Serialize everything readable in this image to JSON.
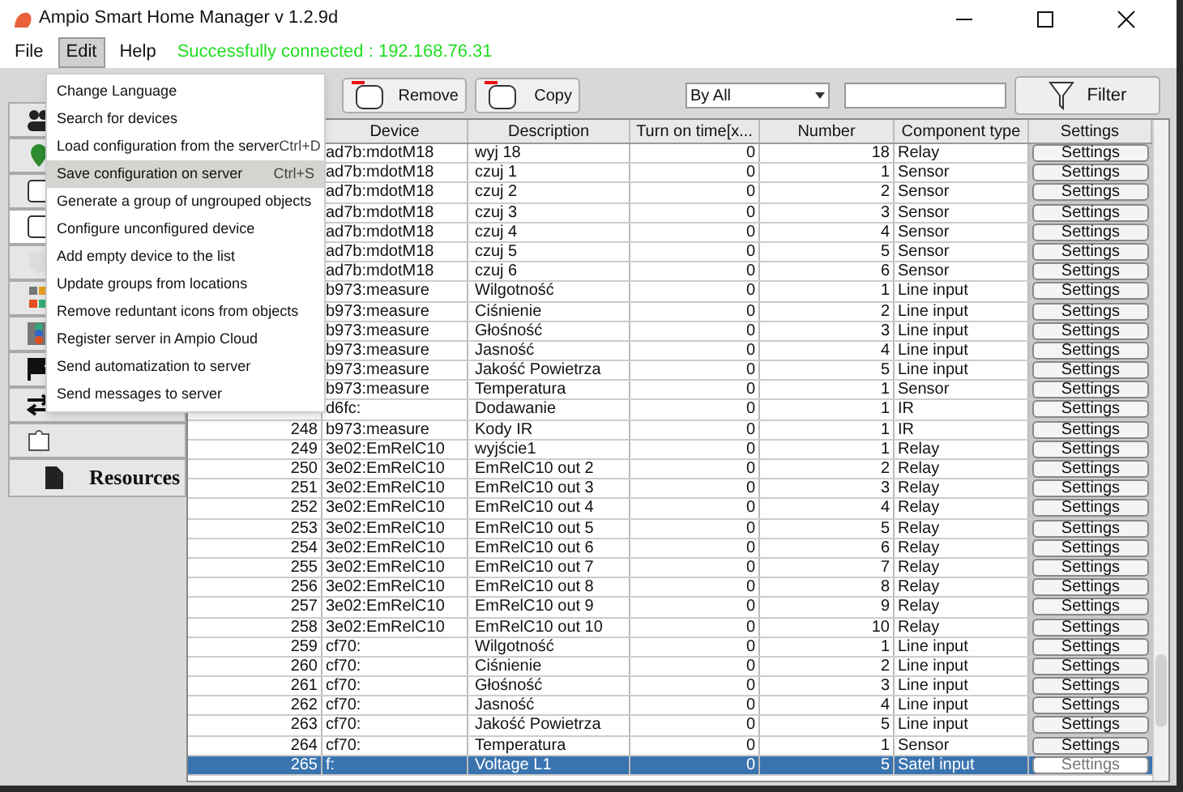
{
  "window": {
    "title": "Ampio Smart Home Manager v 1.2.9d"
  },
  "menubar": {
    "items": [
      {
        "label": "File",
        "selected": false
      },
      {
        "label": "Edit",
        "selected": true
      },
      {
        "label": "Help",
        "selected": false
      }
    ],
    "status": "Successfully connected : 192.168.76.31"
  },
  "toolbar": {
    "remove": "Remove",
    "copy": "Copy",
    "filter_select": "By All",
    "filter": "Filter"
  },
  "sidebar": {
    "items": [
      {
        "kind": "people",
        "selected": false
      },
      {
        "kind": "pin",
        "selected": false
      },
      {
        "kind": "box",
        "selected": false
      },
      {
        "kind": "box",
        "selected": true
      },
      {
        "kind": "shield",
        "selected": false
      },
      {
        "kind": "blocks",
        "selected": false
      },
      {
        "kind": "dots",
        "selected": false
      },
      {
        "kind": "flag",
        "selected": false
      },
      {
        "kind": "arrows",
        "selected": false
      },
      {
        "kind": "puzzle",
        "selected": false
      }
    ],
    "resources": "Resources"
  },
  "menu": {
    "items": [
      {
        "label": "Change Language",
        "selected": false
      },
      {
        "label": "Search for devices",
        "selected": false
      },
      {
        "label": "Load configuration from the server",
        "shortcut": "Ctrl+D",
        "selected": false
      },
      {
        "label": "Save configuration on server",
        "shortcut": "Ctrl+S",
        "selected": true
      },
      {
        "label": "Generate a group of ungrouped objects",
        "selected": false
      },
      {
        "label": "Configure unconfigured device",
        "selected": false
      },
      {
        "label": "Add empty device to the list",
        "selected": false
      },
      {
        "label": "Update groups from locations",
        "selected": false
      },
      {
        "label": "Remove reduntant icons from objects",
        "selected": false
      },
      {
        "label": "Register server in Ampio Cloud",
        "selected": false
      },
      {
        "label": "Send automatization to server",
        "selected": false
      },
      {
        "label": "Send messages to server",
        "selected": false
      }
    ]
  },
  "table": {
    "columns": [
      "Device",
      "Description",
      "Turn on time[x...",
      "Number",
      "Component type",
      "Settings"
    ],
    "rows": [
      {
        "device": "ad7b:mdotM18",
        "description": "wyj 18",
        "time": "0",
        "number": "18",
        "type": "Relay",
        "settings": "Settings",
        "selected": false
      },
      {
        "device": "ad7b:mdotM18",
        "description": "czuj 1",
        "time": "0",
        "number": "1",
        "type": "Sensor",
        "settings": "Settings",
        "selected": false
      },
      {
        "device": "ad7b:mdotM18",
        "description": "czuj 2",
        "time": "0",
        "number": "2",
        "type": "Sensor",
        "settings": "Settings",
        "selected": false
      },
      {
        "device": "ad7b:mdotM18",
        "description": "czuj 3",
        "time": "0",
        "number": "3",
        "type": "Sensor",
        "settings": "Settings",
        "selected": false
      },
      {
        "device": "ad7b:mdotM18",
        "description": "czuj 4",
        "time": "0",
        "number": "4",
        "type": "Sensor",
        "settings": "Settings",
        "selected": false
      },
      {
        "device": "ad7b:mdotM18",
        "description": "czuj 5",
        "time": "0",
        "number": "5",
        "type": "Sensor",
        "settings": "Settings",
        "selected": false
      },
      {
        "device": "ad7b:mdotM18",
        "description": "czuj 6",
        "time": "0",
        "number": "6",
        "type": "Sensor",
        "settings": "Settings",
        "selected": false
      },
      {
        "device": "b973:measure",
        "description": "Wilgotność",
        "time": "0",
        "number": "1",
        "type": "Line input",
        "settings": "Settings",
        "selected": false
      },
      {
        "device": "b973:measure",
        "description": "Ciśnienie",
        "time": "0",
        "number": "2",
        "type": "Line input",
        "settings": "Settings",
        "selected": false
      },
      {
        "device": "b973:measure",
        "description": "Głośność",
        "time": "0",
        "number": "3",
        "type": "Line input",
        "settings": "Settings",
        "selected": false
      },
      {
        "device": "b973:measure",
        "description": "Jasność",
        "time": "0",
        "number": "4",
        "type": "Line input",
        "settings": "Settings",
        "selected": false
      },
      {
        "device": "b973:measure",
        "description": "Jakość Powietrza",
        "time": "0",
        "number": "5",
        "type": "Line input",
        "settings": "Settings",
        "selected": false
      },
      {
        "device": "b973:measure",
        "description": "Temperatura",
        "time": "0",
        "number": "1",
        "type": "Sensor",
        "settings": "Settings",
        "selected": false
      },
      {
        "device": "d6fc:",
        "description": "Dodawanie",
        "time": "0",
        "number": "1",
        "type": "IR",
        "settings": "Settings",
        "selected": false
      },
      {
        "id": "248",
        "device": "b973:measure",
        "description": "Kody IR",
        "time": "0",
        "number": "1",
        "type": "IR",
        "settings": "Settings",
        "selected": false
      },
      {
        "id": "249",
        "device": "3e02:EmRelC10",
        "description": "wyjście1",
        "time": "0",
        "number": "1",
        "type": "Relay",
        "settings": "Settings",
        "selected": false
      },
      {
        "id": "250",
        "device": "3e02:EmRelC10",
        "description": "EmRelC10 out 2",
        "time": "0",
        "number": "2",
        "type": "Relay",
        "settings": "Settings",
        "selected": false
      },
      {
        "id": "251",
        "device": "3e02:EmRelC10",
        "description": "EmRelC10 out 3",
        "time": "0",
        "number": "3",
        "type": "Relay",
        "settings": "Settings",
        "selected": false
      },
      {
        "id": "252",
        "device": "3e02:EmRelC10",
        "description": "EmRelC10 out 4",
        "time": "0",
        "number": "4",
        "type": "Relay",
        "settings": "Settings",
        "selected": false
      },
      {
        "id": "253",
        "device": "3e02:EmRelC10",
        "description": "EmRelC10 out 5",
        "time": "0",
        "number": "5",
        "type": "Relay",
        "settings": "Settings",
        "selected": false
      },
      {
        "id": "254",
        "device": "3e02:EmRelC10",
        "description": "EmRelC10 out 6",
        "time": "0",
        "number": "6",
        "type": "Relay",
        "settings": "Settings",
        "selected": false
      },
      {
        "id": "255",
        "device": "3e02:EmRelC10",
        "description": "EmRelC10 out 7",
        "time": "0",
        "number": "7",
        "type": "Relay",
        "settings": "Settings",
        "selected": false
      },
      {
        "id": "256",
        "device": "3e02:EmRelC10",
        "description": "EmRelC10 out 8",
        "time": "0",
        "number": "8",
        "type": "Relay",
        "settings": "Settings",
        "selected": false
      },
      {
        "id": "257",
        "device": "3e02:EmRelC10",
        "description": "EmRelC10 out 9",
        "time": "0",
        "number": "9",
        "type": "Relay",
        "settings": "Settings",
        "selected": false
      },
      {
        "id": "258",
        "device": "3e02:EmRelC10",
        "description": "EmRelC10 out 10",
        "time": "0",
        "number": "10",
        "type": "Relay",
        "settings": "Settings",
        "selected": false
      },
      {
        "id": "259",
        "device": "cf70:",
        "description": "Wilgotność",
        "time": "0",
        "number": "1",
        "type": "Line input",
        "settings": "Settings",
        "selected": false
      },
      {
        "id": "260",
        "device": "cf70:",
        "description": "Ciśnienie",
        "time": "0",
        "number": "2",
        "type": "Line input",
        "settings": "Settings",
        "selected": false
      },
      {
        "id": "261",
        "device": "cf70:",
        "description": "Głośność",
        "time": "0",
        "number": "3",
        "type": "Line input",
        "settings": "Settings",
        "selected": false
      },
      {
        "id": "262",
        "device": "cf70:",
        "description": "Jasność",
        "time": "0",
        "number": "4",
        "type": "Line input",
        "settings": "Settings",
        "selected": false
      },
      {
        "id": "263",
        "device": "cf70:",
        "description": "Jakość Powietrza",
        "time": "0",
        "number": "5",
        "type": "Line input",
        "settings": "Settings",
        "selected": false
      },
      {
        "id": "264",
        "device": "cf70:",
        "description": "Temperatura",
        "time": "0",
        "number": "1",
        "type": "Sensor",
        "settings": "Settings",
        "selected": false
      },
      {
        "id": "265",
        "device": "f:",
        "description": "Voltage L1",
        "time": "0",
        "number": "5",
        "type": "Satel input",
        "settings": "Settings",
        "selected": true
      }
    ]
  }
}
